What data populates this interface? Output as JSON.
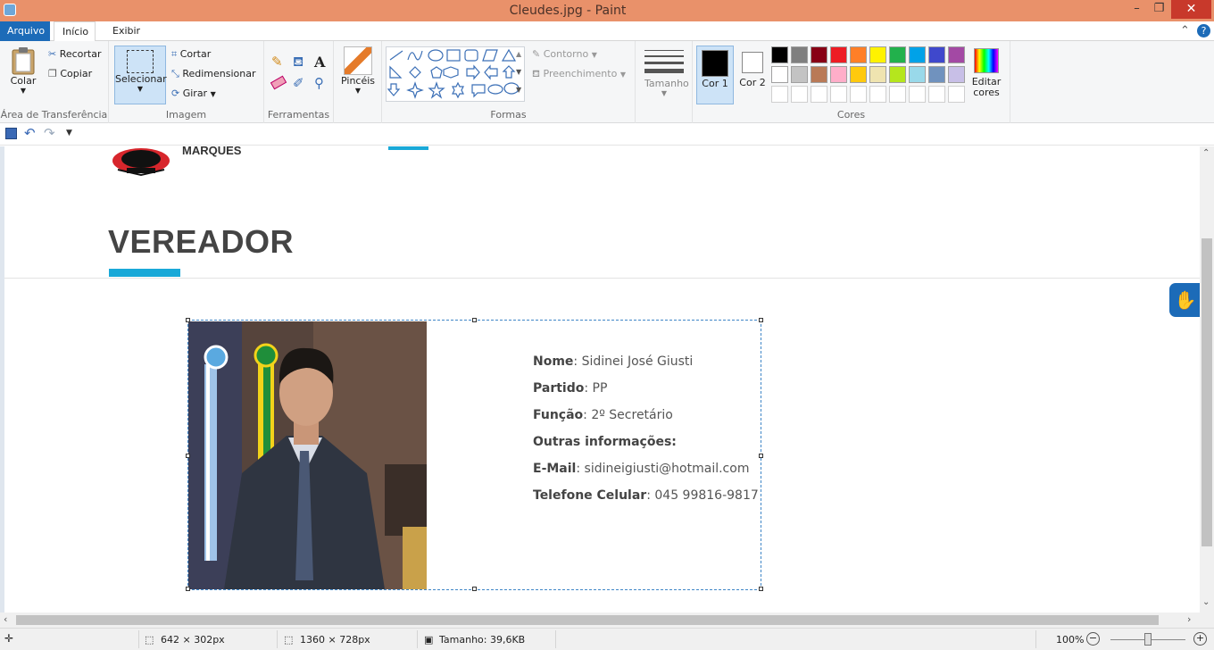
{
  "window": {
    "title": "Cleudes.jpg - Paint",
    "minimize": "–",
    "maximize": "❐",
    "close": "✕"
  },
  "tabs": {
    "file": "Arquivo",
    "home": "Início",
    "view": "Exibir"
  },
  "ribbon": {
    "clipboard": {
      "paste": "Colar",
      "cut": "Recortar",
      "copy": "Copiar",
      "label": "Área de Transferência"
    },
    "image": {
      "select": "Selecionar",
      "crop": "Cortar",
      "resize": "Redimensionar",
      "rotate": "Girar",
      "label": "Imagem"
    },
    "tools": {
      "label": "Ferramentas"
    },
    "brushes": {
      "label": "Pincéis"
    },
    "shapes": {
      "outline": "Contorno",
      "fill": "Preenchimento",
      "label": "Formas"
    },
    "size": {
      "label": "Tamanho"
    },
    "colors": {
      "color1": "Cor 1",
      "color2": "Cor 2",
      "edit": "Editar cores",
      "label": "Cores",
      "row1": [
        "#000000",
        "#7f7f7f",
        "#880015",
        "#ed1c24",
        "#ff7f27",
        "#fff200",
        "#22b14c",
        "#00a2e8",
        "#3f48cc",
        "#a349a4"
      ],
      "row2": [
        "#ffffff",
        "#c3c3c3",
        "#b97a57",
        "#ffaec9",
        "#ffc90e",
        "#efe4b0",
        "#b5e61d",
        "#99d9ea",
        "#7092be",
        "#c8bfe7"
      ]
    }
  },
  "page": {
    "logo_text": "MARQUES",
    "heading": "VEREADOR",
    "accent": "#19a9d8",
    "info": {
      "name_label": "Nome",
      "name_value": ": Sidinei José Giusti",
      "party_label": "Partido",
      "party_value": ": PP",
      "role_label": "Função",
      "role_value": ": 2º Secretário",
      "other_label": "Outras informações:",
      "email_label": "E-Mail",
      "email_value": ": sidineigiusti@hotmail.com",
      "phone_label": "Telefone Celular",
      "phone_value": ": 045 99816-9817"
    }
  },
  "status": {
    "selection": "642 × 302px",
    "image_size": "1360 × 728px",
    "file_size": "Tamanho: 39,6KB",
    "zoom": "100%"
  }
}
